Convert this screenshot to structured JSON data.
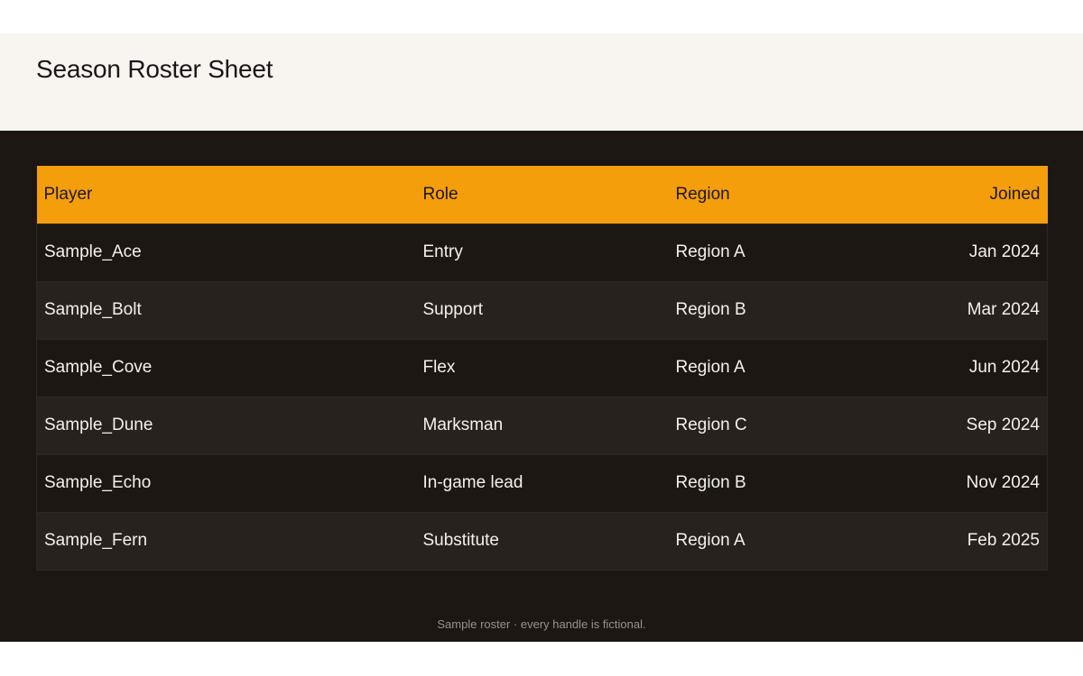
{
  "page": {
    "title": "Season Roster Sheet",
    "footnote": "Sample roster · every handle is fictional."
  },
  "table": {
    "columns": [
      "Player",
      "Role",
      "Region",
      "Joined"
    ],
    "rows": [
      {
        "player": "Sample_Ace",
        "role": "Entry",
        "region": "Region A",
        "joined": "Jan 2024"
      },
      {
        "player": "Sample_Bolt",
        "role": "Support",
        "region": "Region B",
        "joined": "Mar 2024"
      },
      {
        "player": "Sample_Cove",
        "role": "Flex",
        "region": "Region A",
        "joined": "Jun 2024"
      },
      {
        "player": "Sample_Dune",
        "role": "Marksman",
        "region": "Region C",
        "joined": "Sep 2024"
      },
      {
        "player": "Sample_Echo",
        "role": "In-game lead",
        "region": "Region B",
        "joined": "Nov 2024"
      },
      {
        "player": "Sample_Fern",
        "role": "Substitute",
        "region": "Region A",
        "joined": "Feb 2025"
      }
    ]
  },
  "colors": {
    "header_band": "#f8f5f0",
    "background": "#1c1713",
    "accent": "#f59e0b",
    "row_alt": "#27221e"
  }
}
